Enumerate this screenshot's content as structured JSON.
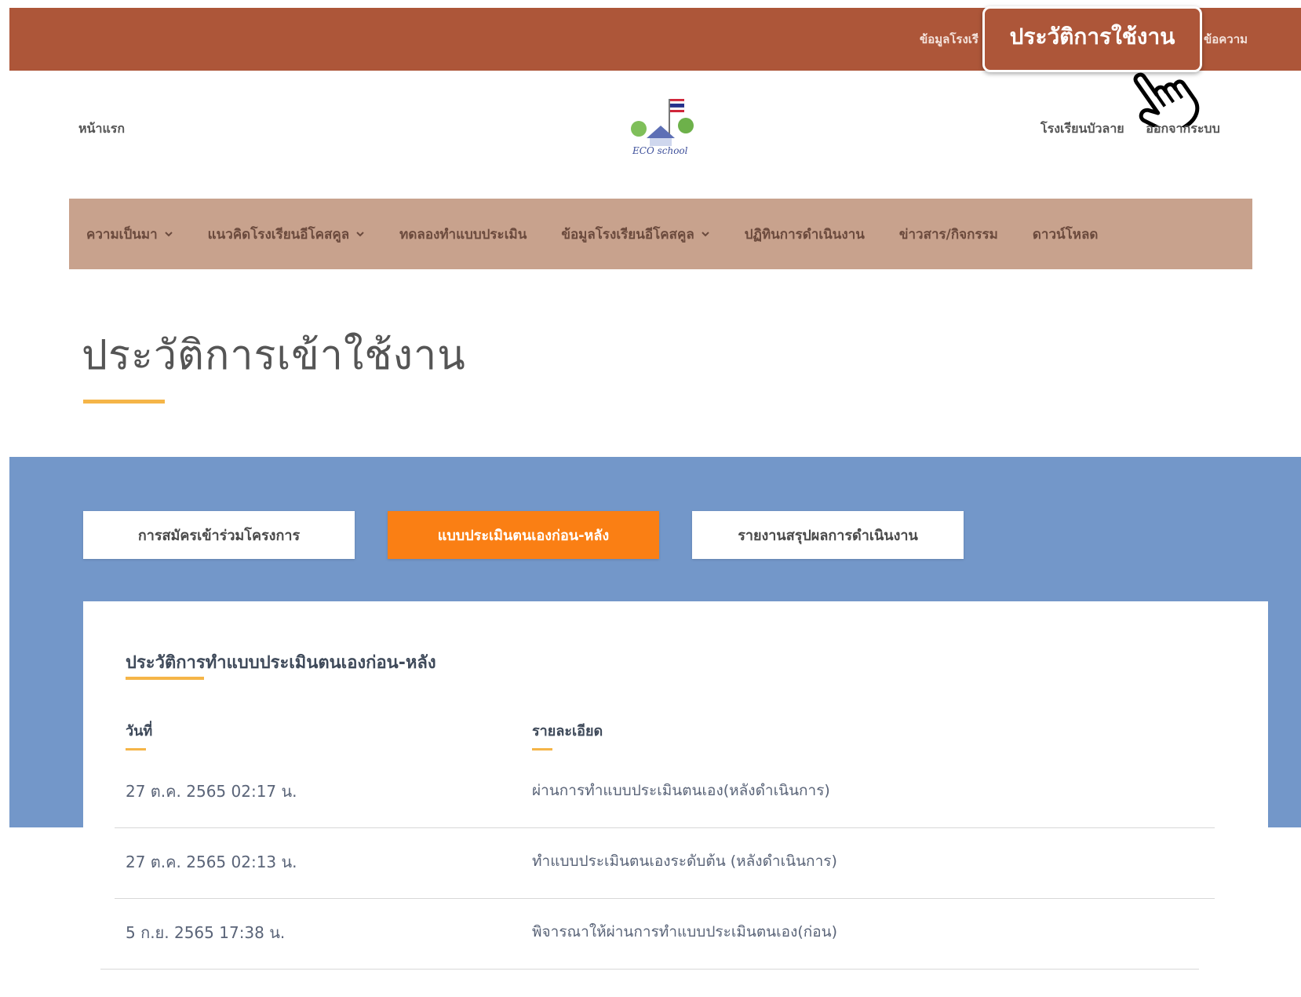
{
  "topbar": {
    "school_info_partial": "ข้อมูลโรงเรี",
    "message_partial": "ข้อความ",
    "highlight_label": "ประวัติการใช้งาน"
  },
  "header": {
    "home": "หน้าแรก",
    "school_name": "โรงเรียนบัวลาย",
    "logout": "ออกจากระบบ",
    "logo_text": "ECO school"
  },
  "nav": {
    "items": [
      {
        "label": "ความเป็นมา",
        "has_dropdown": true
      },
      {
        "label": "แนวคิดโรงเรียนอีโคสคูล",
        "has_dropdown": true
      },
      {
        "label": "ทดลองทำแบบประเมิน",
        "has_dropdown": false
      },
      {
        "label": "ข้อมูลโรงเรียนอีโคสคูล",
        "has_dropdown": true
      },
      {
        "label": "ปฏิทินการดำเนินงาน",
        "has_dropdown": false
      },
      {
        "label": "ข่าวสาร/กิจกรรม",
        "has_dropdown": false
      },
      {
        "label": "ดาวน์โหลด",
        "has_dropdown": false
      }
    ]
  },
  "page": {
    "title": "ประวัติการเข้าใช้งาน"
  },
  "tabs": [
    {
      "label": "การสมัครเข้าร่วมโครงการ",
      "active": false
    },
    {
      "label": "แบบประเมินตนเองก่อน-หลัง",
      "active": true
    },
    {
      "label": "รายงานสรุปผลการดำเนินงาน",
      "active": false
    }
  ],
  "history": {
    "section_title": "ประวัติการทำแบบประเมินตนเองก่อน-หลัง",
    "columns": {
      "date": "วันที่",
      "detail": "รายละเอียด"
    },
    "rows": [
      {
        "date": "27 ต.ค. 2565 02:17 น.",
        "detail": "ผ่านการทำแบบประเมินตนเอง(หลังดำเนินการ)"
      },
      {
        "date": "27 ต.ค. 2565 02:13 น.",
        "detail": "ทำแบบประเมินตนเองระดับต้น (หลังดำเนินการ)"
      },
      {
        "date": "5 ก.ย. 2565 17:38 น.",
        "detail": "พิจารณาให้ผ่านการทำแบบประเมินตนเอง(ก่อน)"
      }
    ]
  },
  "colors": {
    "topbar": "#ad5639",
    "nav": "#c8a28d",
    "blue_band": "#7397c9",
    "active_tab": "#fa7f14",
    "accent_underline": "#f5b548"
  },
  "icons": {
    "cursor": "pointing-hand-icon",
    "dropdown": "chevron-down-icon",
    "logo": "eco-school-logo-icon"
  }
}
